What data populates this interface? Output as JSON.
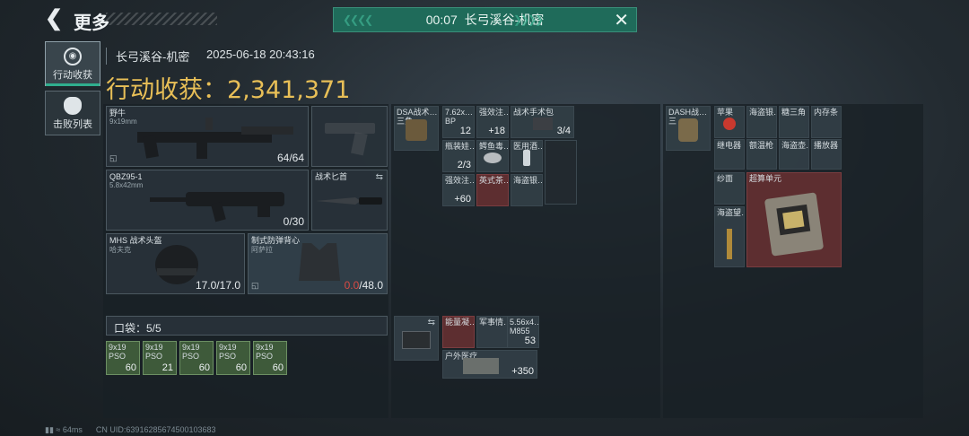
{
  "header": {
    "back_icon": "back-arrow-icon",
    "title": "更多"
  },
  "topbar": {
    "timer": "00:07",
    "map": "长弓溪谷-机密"
  },
  "tabs": [
    {
      "label": "行动收获",
      "icon": "loot-icon",
      "active": true
    },
    {
      "label": "击败列表",
      "icon": "skull-icon",
      "active": false
    }
  ],
  "info": {
    "map": "长弓溪谷-机密",
    "datetime": "2025-06-18 20:43:16"
  },
  "harvest": {
    "label": "行动收获：",
    "value": "2,341,371"
  },
  "weapons": {
    "primary": {
      "name": "野牛",
      "caliber": "9x19mm",
      "ammo": "64/64"
    },
    "secondary": {
      "name": "QBZ95-1",
      "caliber": "5.8x42mm",
      "ammo": "0/30"
    },
    "knife": {
      "name": "战术匕首"
    },
    "helmet": {
      "name": "MHS 战术头盔",
      "sub": "哈夫克",
      "durability": "17.0/17.0"
    },
    "armor": {
      "name": "制式防弹背心",
      "sub": "阿萨拉",
      "durability_cur": "0.0",
      "durability_max": "/48.0"
    }
  },
  "pocket": {
    "label": "口袋：5/5",
    "items": [
      {
        "name": "9x19",
        "sub": "PSO",
        "qty": "60"
      },
      {
        "name": "9x19",
        "sub": "PSO",
        "qty": "21"
      },
      {
        "name": "9x19",
        "sub": "PSO",
        "qty": "60"
      },
      {
        "name": "9x19",
        "sub": "PSO",
        "qty": "60"
      },
      {
        "name": "9x19",
        "sub": "PSO",
        "qty": "60"
      }
    ]
  },
  "chest_rig": {
    "name": "DSA战术…",
    "sub": "三角",
    "items": [
      {
        "name": "7.62x…",
        "sub": "BP",
        "qty": "12"
      },
      {
        "name": "强效注…",
        "qty": "18"
      },
      {
        "name": "战术手术包",
        "qty": "3/4"
      },
      {
        "name": "瓶装娃…",
        "qty": "2/3"
      },
      {
        "name": "鳄鱼毒…",
        "qty": ""
      },
      {
        "name": "医用酒…",
        "qty": ""
      },
      {
        "name": "强效注…",
        "qty": "60"
      },
      {
        "name": "英式茶…",
        "qty": ""
      },
      {
        "name": "海盗银…",
        "qty": ""
      }
    ]
  },
  "pack_slot": {
    "items": [
      {
        "name": "能量凝…"
      },
      {
        "name": "军事情…"
      },
      {
        "name": "5.56x4…",
        "sub": "M855",
        "qty": "53"
      },
      {
        "name": "户外医疗…",
        "qty": "350"
      }
    ]
  },
  "backpack": {
    "name": "DASH战…",
    "sub": "三",
    "items": [
      {
        "name": "苹果"
      },
      {
        "name": "海盗银…"
      },
      {
        "name": "糖三角"
      },
      {
        "name": "内存条"
      },
      {
        "name": "继电器"
      },
      {
        "name": "额温枪"
      },
      {
        "name": "海盗壶…"
      },
      {
        "name": "播放器"
      },
      {
        "name": "纱面"
      },
      {
        "name": "超算单元"
      },
      {
        "name": "海盗望…"
      }
    ]
  },
  "footer": {
    "ping": "64ms",
    "uid": "CN UID:6391628567450010368​3"
  }
}
